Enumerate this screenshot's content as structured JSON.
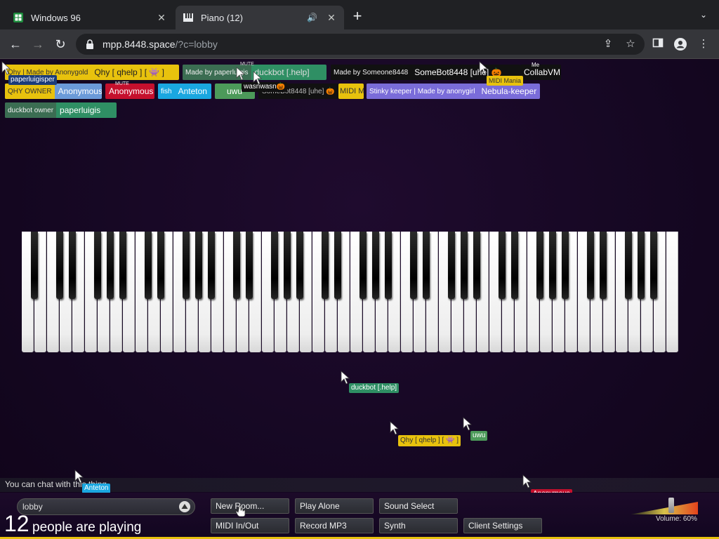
{
  "browser": {
    "tabs": [
      {
        "title": "Windows 96",
        "active": false
      },
      {
        "title": "Piano (12)",
        "active": true
      }
    ],
    "url_host": "mpp.8448.space",
    "url_path": "/?c=lobby"
  },
  "tags": {
    "row1": [
      {
        "badge": "Qhy | Made by Anonygold",
        "name": "Qhy [ qhelp ] [ 👾 ]"
      },
      {
        "badge": "Made by paperluigis",
        "sub": "MUTE",
        "name": "duckbot [.help]"
      },
      {
        "badge": "Made by Someone8448",
        "name": "SomeBot8448 [uhe] 🎃"
      },
      {
        "sub": "Me",
        "name": "CollabVM"
      }
    ],
    "row2": [
      {
        "badge": "QHY OWNER",
        "name": "Anonymous"
      },
      {
        "sub": "MUTE",
        "name": "Anonymous"
      },
      {
        "badge": "fish",
        "name": "Anteton"
      },
      {
        "name": "uwu"
      },
      {
        "name": "SomeBot8448 [uhe] 🎃"
      },
      {
        "name": "MIDI Mania"
      },
      {
        "badge": "Stinky keeper | Made by anonygirl",
        "name": "Nebula-keeper"
      }
    ],
    "row3": [
      {
        "badge": "duckbot owner",
        "name": "paperluigis"
      }
    ],
    "overlays": [
      "paperluigisper",
      "wasnwasn🎃",
      "MIDI Mania"
    ]
  },
  "cursors": [
    "duckbot [.help]",
    "Qhy [ qhelp ] [ 👾 ]",
    "uwu",
    "Anteton",
    "Anonymous"
  ],
  "chat": {
    "hint": "You can chat with this thing."
  },
  "controls": {
    "room": "lobby",
    "count": "12",
    "count_label": "people are playing",
    "buttons": {
      "new_room": "New Room...",
      "play_alone": "Play Alone",
      "sound_select": "Sound Select",
      "midi": "MIDI In/Out",
      "record": "Record MP3",
      "synth": "Synth",
      "client_settings": "Client Settings"
    },
    "volume_label": "Volume: 60%",
    "volume": 0.6
  },
  "colors": {
    "qhy": "#e8c20d",
    "duckbot": "#2f8f64",
    "owner": "#6b9ad8",
    "anon_red": "#c5102d",
    "fish": "#1aa7e0",
    "uwu": "#4c9a5a",
    "somebot": "#2b2b2b",
    "nebula": "#7a6cd9"
  }
}
